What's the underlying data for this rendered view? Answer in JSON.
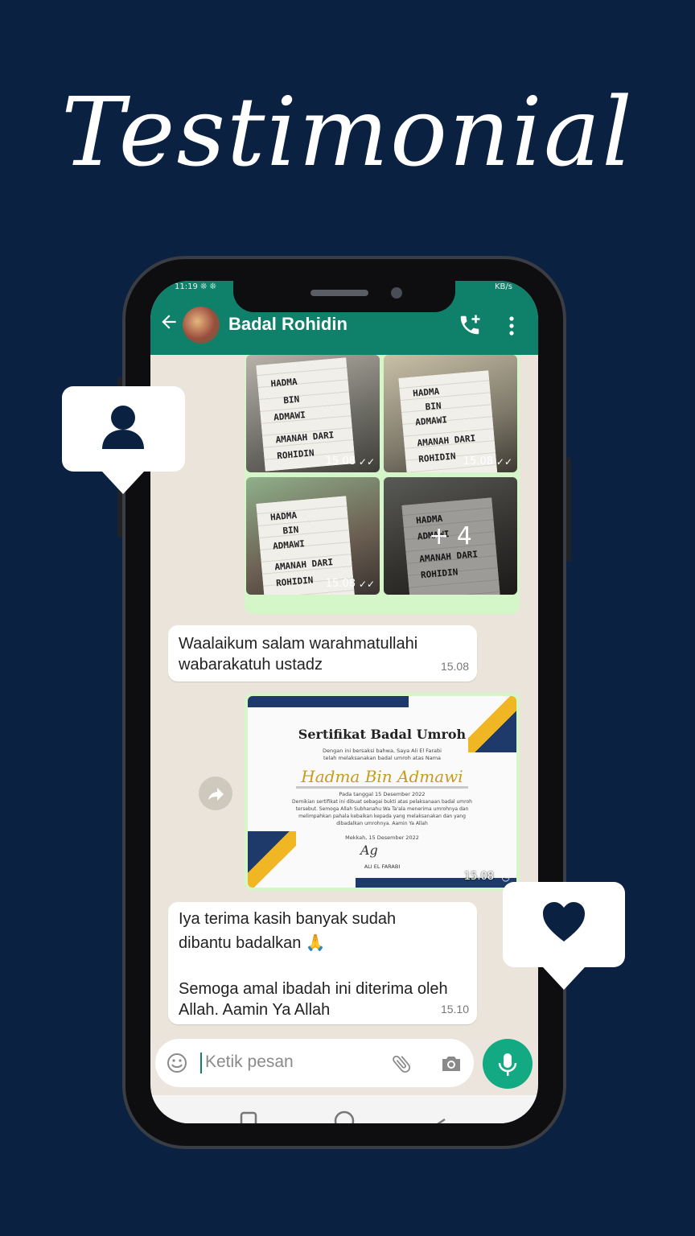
{
  "page": {
    "title": "Testimonial"
  },
  "status_bar": {
    "left": "11:19 ❊ ❊",
    "right": "KB/s"
  },
  "chat_header": {
    "contact_name": "Badal Rohidin"
  },
  "photo_grid": {
    "tiles": [
      {
        "lines": [
          "HADMA",
          "BIN",
          "ADMAWI",
          "AMANAH DARI",
          "ROHIDIN"
        ],
        "time": "15.08"
      },
      {
        "lines": [
          "HADMA",
          "BIN",
          "ADMAWI",
          "AMANAH DARI",
          "ROHIDIN"
        ],
        "time": "15.08"
      },
      {
        "lines": [
          "HADMA",
          "BIN",
          "ADMAWI",
          "AMANAH DARI",
          "ROHIDIN"
        ],
        "time": "15.08"
      },
      {
        "lines": [
          "HADMA",
          "ADMAWI",
          "AMANAH DARI",
          "ROHIDIN"
        ],
        "time": ""
      }
    ],
    "more_count": "+ 4"
  },
  "messages": [
    {
      "text_line1": "Waalaikum salam warahmatullahi",
      "text_line2": "wabarakatuh ustadz",
      "time": "15.08"
    },
    {
      "text_line1": "Iya terima kasih banyak sudah",
      "text_line2": "dibantu badalkan 🙏",
      "text_line3": "Semoga amal ibadah ini diterima oleh",
      "text_line4": "Allah. Aamin Ya Allah",
      "time": "15.10"
    }
  ],
  "certificate": {
    "title": "Sertifikat Badal Umroh",
    "intro1": "Dengan ini bersaksi bahwa, Saya Ali El Farabi",
    "intro2": "telah melaksanakan badal umroh atas Nama",
    "name": "Hadma Bin Admawi",
    "date_line": "Pada tanggal 15 Desember 2022",
    "body1": "Demikian sertifikat ini dibuat sebagai bukti atas pelaksanaan badal umroh",
    "body2": "tersebut. Semoga Allah Subhanahu Wa Ta'ala menerima umrohnya dan",
    "body3": "melimpahkan pahala kebaikan kepada yang melaksanakan dan yang",
    "body4": "dibadalkan umrohnya. Aamin Ya Allah",
    "place_date": "Mekkah, 15 Desember 2022",
    "signature": "Ag",
    "signer": "ALI EL FARABI",
    "time": "15.08"
  },
  "input": {
    "placeholder": "Ketik pesan"
  },
  "colors": {
    "background": "#0b2142",
    "header": "#0f8069",
    "mic": "#12a983",
    "outgoing_bubble": "#d5f6c8"
  },
  "icons": {
    "back": "arrow-left-icon",
    "call": "add-call-icon",
    "menu": "more-vert-icon",
    "emoji": "emoji-icon",
    "attach": "paperclip-icon",
    "camera": "camera-icon",
    "mic": "mic-icon",
    "forward": "forward-icon",
    "user_card": "user-icon",
    "heart_card": "heart-icon"
  }
}
